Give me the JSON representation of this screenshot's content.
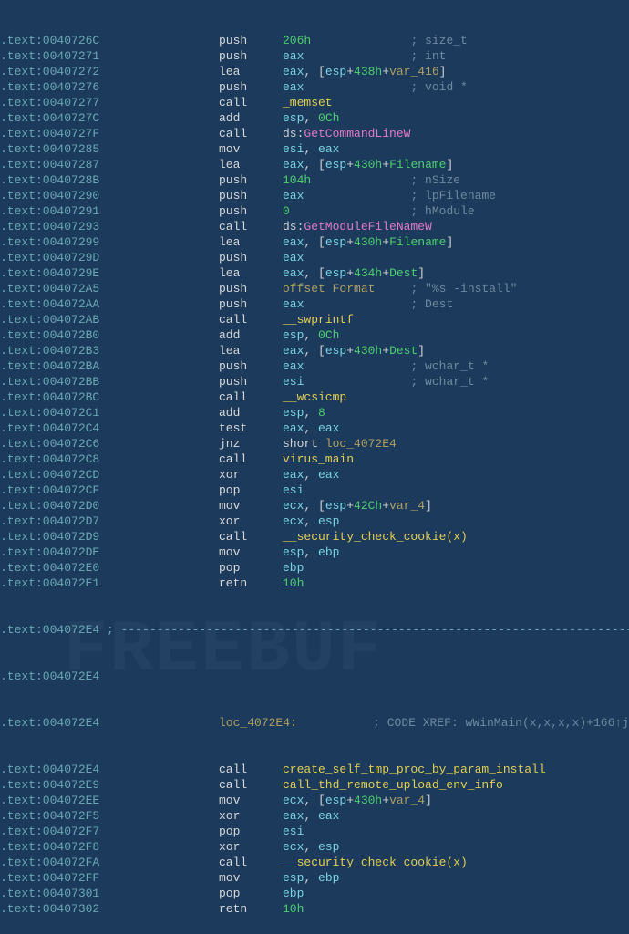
{
  "watermark": "FREEBUF",
  "separator_prefix": ".text:004072E4 ; ",
  "label_line": {
    "addr": ".text:004072E4",
    "label": "loc_4072E4:",
    "xref": "; CODE XREF: wWinMain(x,x,x,x)+166↑j"
  },
  "rows": [
    {
      "addr": ".text:0040726C",
      "mnem": "push",
      "ops": [
        {
          "t": "num",
          "v": "206h"
        }
      ],
      "cmt": "; size_t"
    },
    {
      "addr": ".text:00407271",
      "mnem": "push",
      "ops": [
        {
          "t": "reg",
          "v": "eax"
        }
      ],
      "cmt": "; int"
    },
    {
      "addr": ".text:00407272",
      "mnem": "lea",
      "ops": [
        {
          "t": "reg",
          "v": "eax"
        },
        {
          "t": "txt",
          "v": ", ["
        },
        {
          "t": "reg",
          "v": "esp"
        },
        {
          "t": "txt",
          "v": "+"
        },
        {
          "t": "num",
          "v": "438h"
        },
        {
          "t": "txt",
          "v": "+"
        },
        {
          "t": "off",
          "v": "var_416"
        },
        {
          "t": "txt",
          "v": "]"
        }
      ]
    },
    {
      "addr": ".text:00407276",
      "mnem": "push",
      "ops": [
        {
          "t": "reg",
          "v": "eax"
        }
      ],
      "cmt": "; void *"
    },
    {
      "addr": ".text:00407277",
      "mnem": "call",
      "ops": [
        {
          "t": "fn",
          "v": "_memset"
        }
      ]
    },
    {
      "addr": ".text:0040727C",
      "mnem": "add",
      "ops": [
        {
          "t": "reg",
          "v": "esp"
        },
        {
          "t": "txt",
          "v": ", "
        },
        {
          "t": "num",
          "v": "0Ch"
        }
      ]
    },
    {
      "addr": ".text:0040727F",
      "mnem": "call",
      "ops": [
        {
          "t": "txt",
          "v": "ds:"
        },
        {
          "t": "fn2",
          "v": "GetCommandLineW"
        }
      ]
    },
    {
      "addr": ".text:00407285",
      "mnem": "mov",
      "ops": [
        {
          "t": "reg",
          "v": "esi"
        },
        {
          "t": "txt",
          "v": ", "
        },
        {
          "t": "reg",
          "v": "eax"
        }
      ]
    },
    {
      "addr": ".text:00407287",
      "mnem": "lea",
      "ops": [
        {
          "t": "reg",
          "v": "eax"
        },
        {
          "t": "txt",
          "v": ", ["
        },
        {
          "t": "reg",
          "v": "esp"
        },
        {
          "t": "txt",
          "v": "+"
        },
        {
          "t": "num",
          "v": "430h"
        },
        {
          "t": "txt",
          "v": "+"
        },
        {
          "t": "var",
          "v": "Filename"
        },
        {
          "t": "txt",
          "v": "]"
        }
      ]
    },
    {
      "addr": ".text:0040728B",
      "mnem": "push",
      "ops": [
        {
          "t": "num",
          "v": "104h"
        }
      ],
      "cmt": "; nSize"
    },
    {
      "addr": ".text:00407290",
      "mnem": "push",
      "ops": [
        {
          "t": "reg",
          "v": "eax"
        }
      ],
      "cmt": "; lpFilename"
    },
    {
      "addr": ".text:00407291",
      "mnem": "push",
      "ops": [
        {
          "t": "num",
          "v": "0"
        }
      ],
      "cmt": "; hModule"
    },
    {
      "addr": ".text:00407293",
      "mnem": "call",
      "ops": [
        {
          "t": "txt",
          "v": "ds:"
        },
        {
          "t": "fn2",
          "v": "GetModuleFileNameW"
        }
      ]
    },
    {
      "addr": ".text:00407299",
      "mnem": "lea",
      "ops": [
        {
          "t": "reg",
          "v": "eax"
        },
        {
          "t": "txt",
          "v": ", ["
        },
        {
          "t": "reg",
          "v": "esp"
        },
        {
          "t": "txt",
          "v": "+"
        },
        {
          "t": "num",
          "v": "430h"
        },
        {
          "t": "txt",
          "v": "+"
        },
        {
          "t": "var",
          "v": "Filename"
        },
        {
          "t": "txt",
          "v": "]"
        }
      ]
    },
    {
      "addr": ".text:0040729D",
      "mnem": "push",
      "ops": [
        {
          "t": "reg",
          "v": "eax"
        }
      ]
    },
    {
      "addr": ".text:0040729E",
      "mnem": "lea",
      "ops": [
        {
          "t": "reg",
          "v": "eax"
        },
        {
          "t": "txt",
          "v": ", ["
        },
        {
          "t": "reg",
          "v": "esp"
        },
        {
          "t": "txt",
          "v": "+"
        },
        {
          "t": "num",
          "v": "434h"
        },
        {
          "t": "txt",
          "v": "+"
        },
        {
          "t": "var",
          "v": "Dest"
        },
        {
          "t": "txt",
          "v": "]"
        }
      ]
    },
    {
      "addr": ".text:004072A5",
      "mnem": "push",
      "ops": [
        {
          "t": "off",
          "v": "offset Format"
        }
      ],
      "cmt": "; \"%s -install\""
    },
    {
      "addr": ".text:004072AA",
      "mnem": "push",
      "ops": [
        {
          "t": "reg",
          "v": "eax"
        }
      ],
      "cmt": "; Dest"
    },
    {
      "addr": ".text:004072AB",
      "mnem": "call",
      "ops": [
        {
          "t": "fn",
          "v": "__swprintf"
        }
      ]
    },
    {
      "addr": ".text:004072B0",
      "mnem": "add",
      "ops": [
        {
          "t": "reg",
          "v": "esp"
        },
        {
          "t": "txt",
          "v": ", "
        },
        {
          "t": "num",
          "v": "0Ch"
        }
      ]
    },
    {
      "addr": ".text:004072B3",
      "mnem": "lea",
      "ops": [
        {
          "t": "reg",
          "v": "eax"
        },
        {
          "t": "txt",
          "v": ", ["
        },
        {
          "t": "reg",
          "v": "esp"
        },
        {
          "t": "txt",
          "v": "+"
        },
        {
          "t": "num",
          "v": "430h"
        },
        {
          "t": "txt",
          "v": "+"
        },
        {
          "t": "var",
          "v": "Dest"
        },
        {
          "t": "txt",
          "v": "]"
        }
      ]
    },
    {
      "addr": ".text:004072BA",
      "mnem": "push",
      "ops": [
        {
          "t": "reg",
          "v": "eax"
        }
      ],
      "cmt": "; wchar_t *"
    },
    {
      "addr": ".text:004072BB",
      "mnem": "push",
      "ops": [
        {
          "t": "reg",
          "v": "esi"
        }
      ],
      "cmt": "; wchar_t *"
    },
    {
      "addr": ".text:004072BC",
      "mnem": "call",
      "ops": [
        {
          "t": "fn",
          "v": "__wcsicmp"
        }
      ]
    },
    {
      "addr": ".text:004072C1",
      "mnem": "add",
      "ops": [
        {
          "t": "reg",
          "v": "esp"
        },
        {
          "t": "txt",
          "v": ", "
        },
        {
          "t": "num",
          "v": "8"
        }
      ]
    },
    {
      "addr": ".text:004072C4",
      "mnem": "test",
      "ops": [
        {
          "t": "reg",
          "v": "eax"
        },
        {
          "t": "txt",
          "v": ", "
        },
        {
          "t": "reg",
          "v": "eax"
        }
      ]
    },
    {
      "addr": ".text:004072C6",
      "mnem": "jnz",
      "ops": [
        {
          "t": "txt",
          "v": "short "
        },
        {
          "t": "off",
          "v": "loc_4072E4"
        }
      ]
    },
    {
      "addr": ".text:004072C8",
      "mnem": "call",
      "ops": [
        {
          "t": "fn",
          "v": "virus_main"
        }
      ]
    },
    {
      "addr": ".text:004072CD",
      "mnem": "xor",
      "ops": [
        {
          "t": "reg",
          "v": "eax"
        },
        {
          "t": "txt",
          "v": ", "
        },
        {
          "t": "reg",
          "v": "eax"
        }
      ]
    },
    {
      "addr": ".text:004072CF",
      "mnem": "pop",
      "ops": [
        {
          "t": "reg",
          "v": "esi"
        }
      ]
    },
    {
      "addr": ".text:004072D0",
      "mnem": "mov",
      "ops": [
        {
          "t": "reg",
          "v": "ecx"
        },
        {
          "t": "txt",
          "v": ", ["
        },
        {
          "t": "reg",
          "v": "esp"
        },
        {
          "t": "txt",
          "v": "+"
        },
        {
          "t": "num",
          "v": "42Ch"
        },
        {
          "t": "txt",
          "v": "+"
        },
        {
          "t": "off",
          "v": "var_4"
        },
        {
          "t": "txt",
          "v": "]"
        }
      ]
    },
    {
      "addr": ".text:004072D7",
      "mnem": "xor",
      "ops": [
        {
          "t": "reg",
          "v": "ecx"
        },
        {
          "t": "txt",
          "v": ", "
        },
        {
          "t": "reg",
          "v": "esp"
        }
      ]
    },
    {
      "addr": ".text:004072D9",
      "mnem": "call",
      "ops": [
        {
          "t": "fn",
          "v": "__security_check_cookie(x)"
        }
      ]
    },
    {
      "addr": ".text:004072DE",
      "mnem": "mov",
      "ops": [
        {
          "t": "reg",
          "v": "esp"
        },
        {
          "t": "txt",
          "v": ", "
        },
        {
          "t": "reg",
          "v": "ebp"
        }
      ]
    },
    {
      "addr": ".text:004072E0",
      "mnem": "pop",
      "ops": [
        {
          "t": "reg",
          "v": "ebp"
        }
      ]
    },
    {
      "addr": ".text:004072E1",
      "mnem": "retn",
      "ops": [
        {
          "t": "num",
          "v": "10h"
        }
      ]
    }
  ],
  "rows2": [
    {
      "addr": ".text:004072E4",
      "mnem": "call",
      "ops": [
        {
          "t": "fn",
          "v": "create_self_tmp_proc_by_param_install"
        }
      ]
    },
    {
      "addr": ".text:004072E9",
      "mnem": "call",
      "ops": [
        {
          "t": "fn",
          "v": "call_thd_remote_upload_env_info"
        }
      ]
    },
    {
      "addr": ".text:004072EE",
      "mnem": "mov",
      "ops": [
        {
          "t": "reg",
          "v": "ecx"
        },
        {
          "t": "txt",
          "v": ", ["
        },
        {
          "t": "reg",
          "v": "esp"
        },
        {
          "t": "txt",
          "v": "+"
        },
        {
          "t": "num",
          "v": "430h"
        },
        {
          "t": "txt",
          "v": "+"
        },
        {
          "t": "off",
          "v": "var_4"
        },
        {
          "t": "txt",
          "v": "]"
        }
      ]
    },
    {
      "addr": ".text:004072F5",
      "mnem": "xor",
      "ops": [
        {
          "t": "reg",
          "v": "eax"
        },
        {
          "t": "txt",
          "v": ", "
        },
        {
          "t": "reg",
          "v": "eax"
        }
      ]
    },
    {
      "addr": ".text:004072F7",
      "mnem": "pop",
      "ops": [
        {
          "t": "reg",
          "v": "esi"
        }
      ]
    },
    {
      "addr": ".text:004072F8",
      "mnem": "xor",
      "ops": [
        {
          "t": "reg",
          "v": "ecx"
        },
        {
          "t": "txt",
          "v": ", "
        },
        {
          "t": "reg",
          "v": "esp"
        }
      ]
    },
    {
      "addr": ".text:004072FA",
      "mnem": "call",
      "ops": [
        {
          "t": "fn",
          "v": "__security_check_cookie(x)"
        }
      ]
    },
    {
      "addr": ".text:004072FF",
      "mnem": "mov",
      "ops": [
        {
          "t": "reg",
          "v": "esp"
        },
        {
          "t": "txt",
          "v": ", "
        },
        {
          "t": "reg",
          "v": "ebp"
        }
      ]
    },
    {
      "addr": ".text:00407301",
      "mnem": "pop",
      "ops": [
        {
          "t": "reg",
          "v": "ebp"
        }
      ]
    },
    {
      "addr": ".text:00407302",
      "mnem": "retn",
      "ops": [
        {
          "t": "num",
          "v": "10h"
        }
      ]
    }
  ]
}
